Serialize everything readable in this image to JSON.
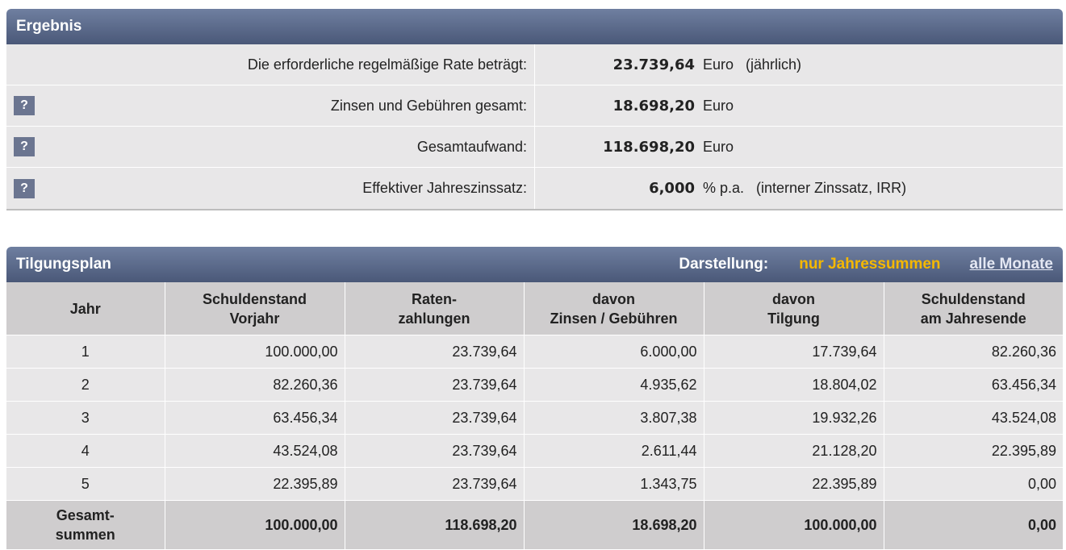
{
  "ergebnis": {
    "title": "Ergebnis",
    "rows": [
      {
        "help": "",
        "label": "Die erforderliche regelmäßige Rate beträgt:",
        "value": "23.739,64",
        "unit": "Euro",
        "note": "(jährlich)"
      },
      {
        "help": "?",
        "label": "Zinsen und Gebühren gesamt:",
        "value": "18.698,20",
        "unit": "Euro",
        "note": ""
      },
      {
        "help": "?",
        "label": "Gesamtaufwand:",
        "value": "118.698,20",
        "unit": "Euro",
        "note": ""
      },
      {
        "help": "?",
        "label": "Effektiver Jahreszinssatz:",
        "value": "6,000",
        "unit": "% p.a.",
        "note": "(interner Zinssatz, IRR)"
      }
    ]
  },
  "tilgungsplan": {
    "title": "Tilgungsplan",
    "darstellung_label": "Darstellung:",
    "option_active": "nur Jahressummen",
    "option_link": "alle Monate",
    "columns": [
      {
        "line1": "Jahr",
        "line2": ""
      },
      {
        "line1": "Schuldenstand",
        "line2": "Vorjahr"
      },
      {
        "line1": "Raten-",
        "line2": "zahlungen"
      },
      {
        "line1": "davon",
        "line2": "Zinsen / Gebühren"
      },
      {
        "line1": "davon",
        "line2": "Tilgung"
      },
      {
        "line1": "Schuldenstand",
        "line2": "am Jahresende"
      }
    ],
    "rows": [
      [
        "1",
        "100.000,00",
        "23.739,64",
        "6.000,00",
        "17.739,64",
        "82.260,36"
      ],
      [
        "2",
        "82.260,36",
        "23.739,64",
        "4.935,62",
        "18.804,02",
        "63.456,34"
      ],
      [
        "3",
        "63.456,34",
        "23.739,64",
        "3.807,38",
        "19.932,26",
        "43.524,08"
      ],
      [
        "4",
        "43.524,08",
        "23.739,64",
        "2.611,44",
        "21.128,20",
        "22.395,89"
      ],
      [
        "5",
        "22.395,89",
        "23.739,64",
        "1.343,75",
        "22.395,89",
        "0,00"
      ]
    ],
    "total": {
      "label_line1": "Gesamt-",
      "label_line2": "summen",
      "values": [
        "100.000,00",
        "118.698,20",
        "18.698,20",
        "100.000,00",
        "0,00"
      ]
    }
  }
}
